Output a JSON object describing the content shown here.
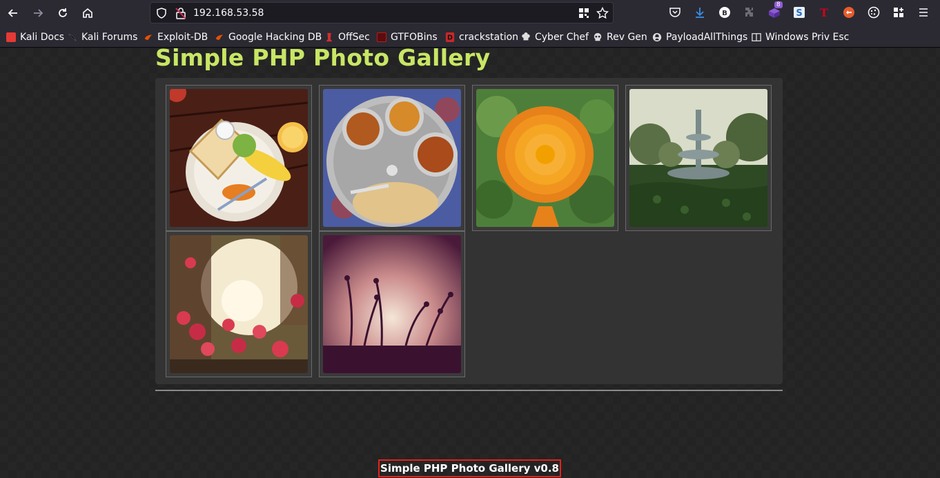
{
  "browser": {
    "url": "192.168.53.58",
    "extension_badge": "8"
  },
  "bookmarks": [
    {
      "label": "Kali Docs",
      "icon": "kali-docs-icon",
      "color": "#e53935"
    },
    {
      "label": "Kali Forums",
      "icon": "kali-dragon-icon",
      "color": "#111111"
    },
    {
      "label": "Exploit-DB",
      "icon": "exploit-db-icon",
      "color": "#e65100"
    },
    {
      "label": "Google Hacking DB",
      "icon": "ghdb-icon",
      "color": "#e65100"
    },
    {
      "label": "OffSec",
      "icon": "offsec-icon",
      "color": "#d32f2f"
    },
    {
      "label": "GTFOBins",
      "icon": "gtfobins-icon",
      "color": "#b71c1c"
    },
    {
      "label": "crackstation",
      "icon": "crackstation-icon",
      "color": "#c62828"
    },
    {
      "label": "Cyber Chef",
      "icon": "chef-hat-icon",
      "color": "#dddddd"
    },
    {
      "label": "Rev Gen",
      "icon": "skull-icon",
      "color": "#dddddd"
    },
    {
      "label": "PayloadAllThings",
      "icon": "github-icon",
      "color": "#dddddd"
    },
    {
      "label": "Windows Priv Esc",
      "icon": "book-icon",
      "color": "#dddddd"
    }
  ],
  "page": {
    "title": "Simple PHP Photo Gallery",
    "footer": "Simple PHP Photo Gallery v0.8"
  },
  "gallery": [
    {
      "subject": "breakfast-plate"
    },
    {
      "subject": "thali-meal"
    },
    {
      "subject": "orange-flower"
    },
    {
      "subject": "garden-fountain"
    },
    {
      "subject": "bougainvillea-sunset"
    },
    {
      "subject": "plant-silhouette"
    }
  ],
  "colors": {
    "title": "#c8e665",
    "footer_border": "#e2231a",
    "toolbar": "#2b2a33"
  }
}
